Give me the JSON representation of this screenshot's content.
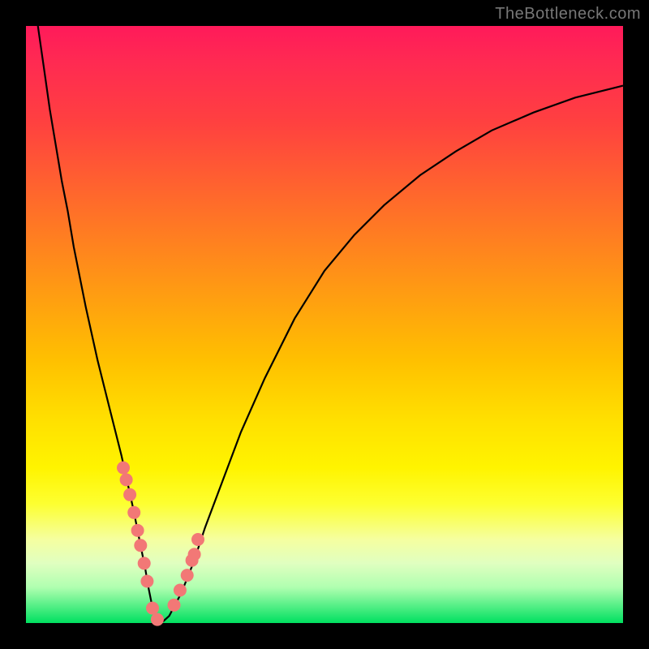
{
  "watermark": "TheBottleneck.com",
  "colors": {
    "background": "#000000",
    "gradient_top": "#ff1a5a",
    "gradient_mid": "#ffe000",
    "gradient_bottom": "#00e060",
    "curve": "#000000",
    "marker": "#f27876"
  },
  "chart_data": {
    "type": "line",
    "title": "",
    "xlabel": "",
    "ylabel": "",
    "xlim": [
      0,
      100
    ],
    "ylim": [
      0,
      100
    ],
    "series": [
      {
        "name": "curve",
        "x": [
          2,
          3,
          4,
          5,
          6,
          7,
          8,
          10,
          12,
          14,
          16,
          18,
          19,
          20,
          20.5,
          21,
          21.5,
          22,
          23,
          24,
          26,
          28,
          30,
          33,
          36,
          40,
          45,
          50,
          55,
          60,
          66,
          72,
          78,
          85,
          92,
          100
        ],
        "y": [
          100,
          93,
          86,
          80,
          74,
          69,
          63,
          53,
          44,
          36,
          28,
          19,
          14,
          9,
          6,
          3.5,
          1.8,
          0.6,
          0.3,
          1.2,
          5,
          10,
          16,
          24,
          32,
          41,
          51,
          59,
          65,
          70,
          75,
          79,
          82.5,
          85.5,
          88,
          90
        ]
      }
    ],
    "markers": {
      "name": "highlighted-points",
      "x": [
        16.3,
        16.8,
        17.4,
        18.1,
        18.7,
        19.2,
        19.8,
        20.3,
        21.2,
        22.0,
        24.8,
        25.8,
        27.0,
        27.8,
        28.2,
        28.8
      ],
      "y": [
        26.0,
        24.0,
        21.5,
        18.5,
        15.5,
        13.0,
        10.0,
        7.0,
        2.5,
        0.6,
        3.0,
        5.5,
        8.0,
        10.5,
        11.5,
        14.0
      ]
    }
  }
}
